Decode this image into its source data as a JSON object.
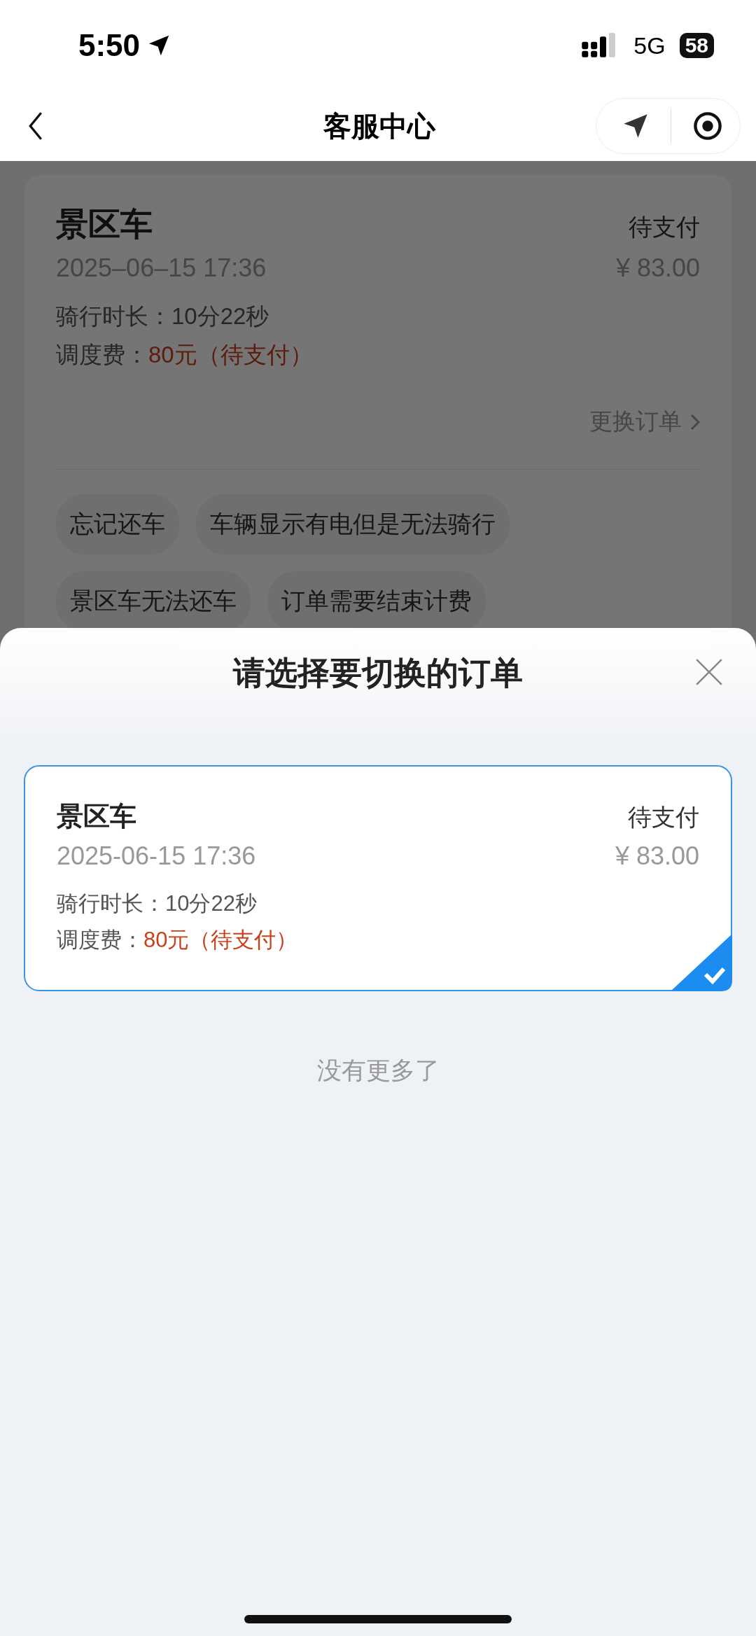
{
  "status_bar": {
    "time": "5:50",
    "network": "5G",
    "battery": "58"
  },
  "nav": {
    "title": "客服中心"
  },
  "current_order": {
    "name": "景区车",
    "status": "待支付",
    "time": "2025–06–15 17:36",
    "amount": "¥ 83.00",
    "duration_label": "骑行时长：",
    "duration": "10分22秒",
    "fee_label": "调度费：",
    "fee": "80元（待支付）",
    "switch_link": "更换订单"
  },
  "issue_tags": [
    "忘记还车",
    "车辆显示有电但是无法骑行",
    "景区车无法还车",
    "订单需要结束计费"
  ],
  "sheet": {
    "title": "请选择要切换的订单",
    "orders": [
      {
        "name": "景区车",
        "status": "待支付",
        "time": "2025-06-15 17:36",
        "amount": "¥ 83.00",
        "duration_label": "骑行时长：",
        "duration": "10分22秒",
        "fee_label": "调度费：",
        "fee": "80元（待支付）",
        "selected": true
      }
    ],
    "end_note": "没有更多了"
  }
}
